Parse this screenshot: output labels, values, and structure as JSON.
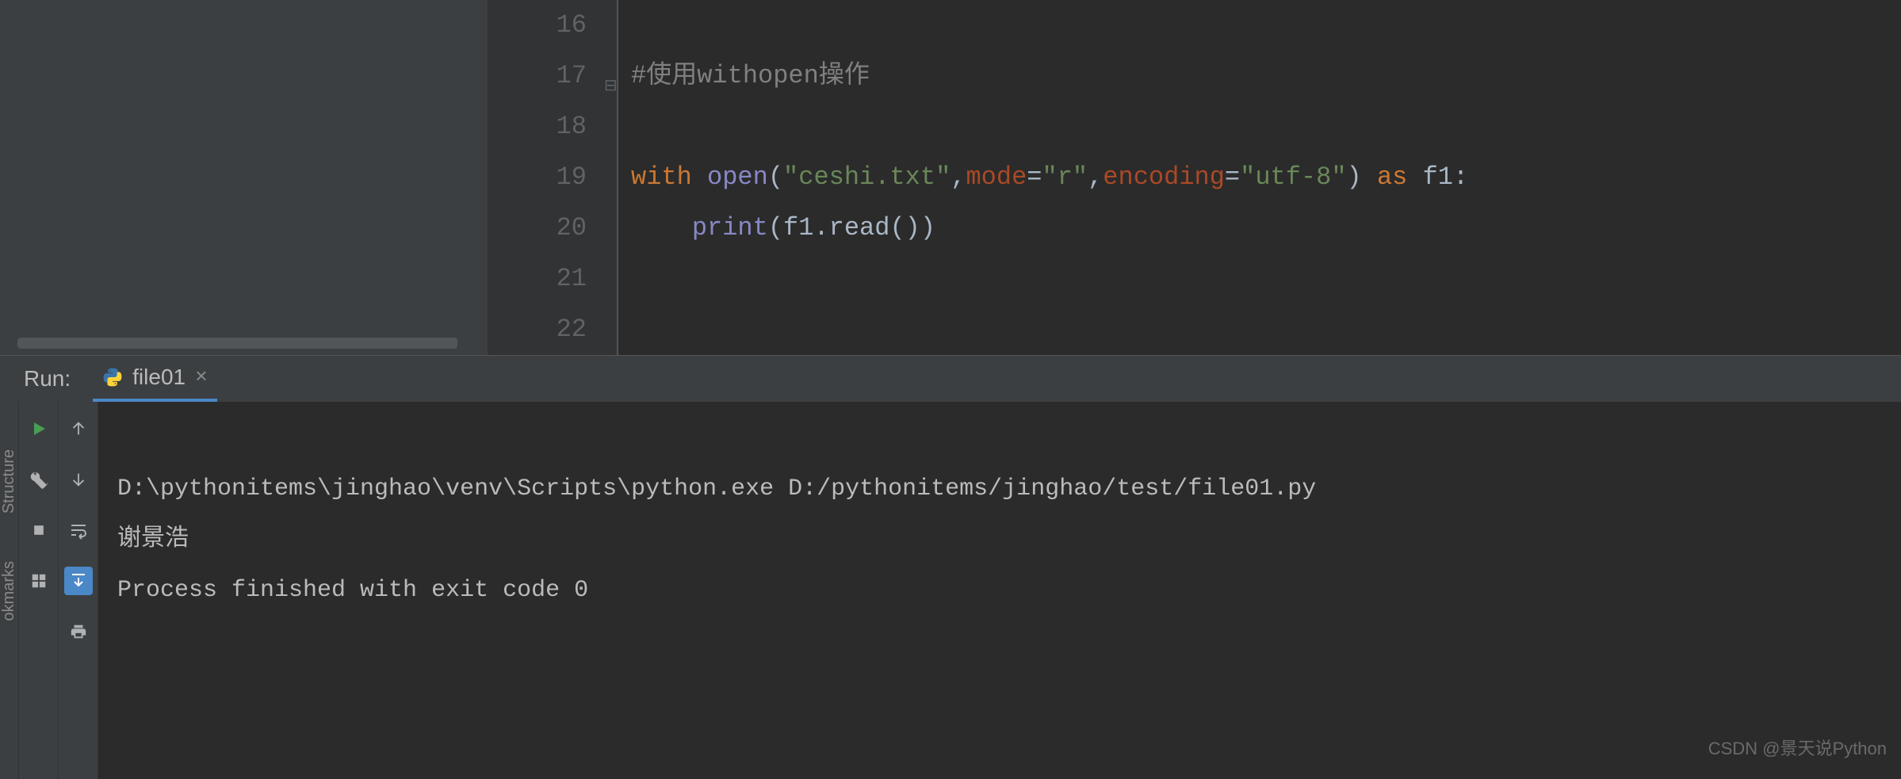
{
  "editor": {
    "line_numbers": [
      "16",
      "17",
      "18",
      "19",
      "20",
      "21",
      "22"
    ],
    "lines": {
      "17": {
        "comment": "#使用withopen操作"
      },
      "19": {
        "kw_with": "with",
        "builtin_open": "open",
        "paren1": "(",
        "str_file": "\"ceshi.txt\"",
        "comma1": ",",
        "param_mode": "mode",
        "eq1": "=",
        "str_mode": "\"r\"",
        "comma2": ",",
        "param_enc": "encoding",
        "eq2": "=",
        "str_enc": "\"utf-8\"",
        "paren2": ")",
        "kw_as": " as ",
        "var_f1": "f1",
        "colon": ":"
      },
      "20": {
        "indent": "    ",
        "builtin_print": "print",
        "paren1": "(",
        "var_f1": "f1",
        "dot": ".",
        "method_read": "read",
        "parens": "()",
        "paren2": ")"
      }
    }
  },
  "run_panel": {
    "label": "Run:",
    "tab_name": "file01",
    "console_lines": [
      "D:\\pythonitems\\jinghao\\venv\\Scripts\\python.exe D:/pythonitems/jinghao/test/file01.py",
      "谢景浩",
      "",
      "Process finished with exit code 0"
    ]
  },
  "side_labels": {
    "structure": "Structure",
    "bookmarks": "okmarks"
  },
  "watermark": "CSDN @景天说Python"
}
